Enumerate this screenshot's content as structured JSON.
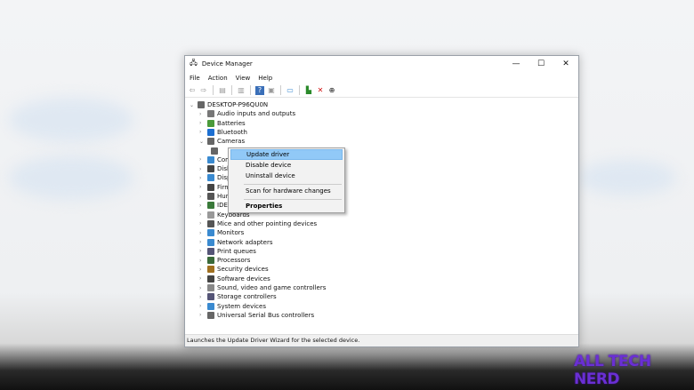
{
  "window": {
    "title": "Device Manager",
    "controls": [
      "—",
      "☐",
      "✕"
    ]
  },
  "menu": [
    "File",
    "Action",
    "View",
    "Help"
  ],
  "toolbar": [
    "back",
    "forward",
    "properties-sheet",
    "show-hidden",
    "help",
    "view",
    "monitor",
    "update-driver",
    "uninstall",
    "download"
  ],
  "tree": {
    "root": "DESKTOP-P96QU0N",
    "items": [
      {
        "label": "Audio inputs and outputs",
        "icon": "speaker-icon"
      },
      {
        "label": "Batteries",
        "icon": "battery-icon"
      },
      {
        "label": "Bluetooth",
        "icon": "bluetooth-icon"
      },
      {
        "label": "Cameras",
        "icon": "camera-icon",
        "expanded": true
      },
      {
        "label": "",
        "icon": "camera-icon",
        "child": true
      },
      {
        "label": "Com",
        "icon": "computer-icon"
      },
      {
        "label": "Disk",
        "icon": "disk-icon"
      },
      {
        "label": "Disp",
        "icon": "display-icon"
      },
      {
        "label": "Firm",
        "icon": "firmware-icon"
      },
      {
        "label": "Hum",
        "icon": "hid-icon"
      },
      {
        "label": "IDE",
        "icon": "ide-icon"
      },
      {
        "label": "Keyboards",
        "icon": "keyboard-icon"
      },
      {
        "label": "Mice and other pointing devices",
        "icon": "mouse-icon"
      },
      {
        "label": "Monitors",
        "icon": "monitor-icon"
      },
      {
        "label": "Network adapters",
        "icon": "network-icon"
      },
      {
        "label": "Print queues",
        "icon": "printer-icon"
      },
      {
        "label": "Processors",
        "icon": "cpu-icon"
      },
      {
        "label": "Security devices",
        "icon": "security-icon"
      },
      {
        "label": "Software devices",
        "icon": "software-icon"
      },
      {
        "label": "Sound, video and game controllers",
        "icon": "sound-icon"
      },
      {
        "label": "Storage controllers",
        "icon": "storage-icon"
      },
      {
        "label": "System devices",
        "icon": "system-icon"
      },
      {
        "label": "Universal Serial Bus controllers",
        "icon": "usb-icon"
      }
    ]
  },
  "context_menu": {
    "items": [
      "Update driver",
      "Disable device",
      "Uninstall device",
      "Scan for hardware changes",
      "Properties"
    ],
    "highlighted": "Update driver"
  },
  "status": "Launches the Update Driver Wizard for the selected device.",
  "watermark": "ALL TECH NERD",
  "colors": {
    "highlight": "#91c9f7",
    "logo": "#6a2fd4"
  }
}
